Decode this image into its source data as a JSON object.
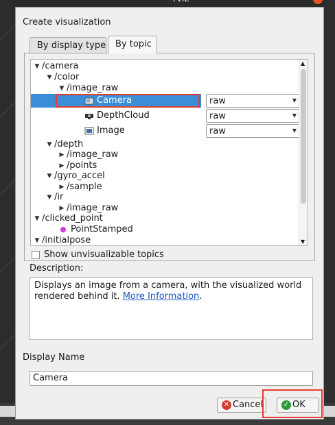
{
  "window": {
    "title": "rviz"
  },
  "dialog": {
    "heading": "Create visualization",
    "tabs": [
      {
        "label": "By display type",
        "active": false
      },
      {
        "label": "By topic",
        "active": true
      }
    ],
    "tree": [
      {
        "label": "/camera",
        "arrow": "down"
      },
      {
        "label": "/color",
        "arrow": "down"
      },
      {
        "label": "/image_raw",
        "arrow": "down"
      },
      {
        "label": "Camera",
        "icon": "camera-icon",
        "combo": "raw",
        "selected": true
      },
      {
        "label": "DepthCloud",
        "icon": "depthcloud-icon",
        "combo": "raw"
      },
      {
        "label": "Image",
        "icon": "image-icon",
        "combo": "raw"
      },
      {
        "label": "/depth",
        "arrow": "down"
      },
      {
        "label": "/image_raw",
        "arrow": "right"
      },
      {
        "label": "/points",
        "arrow": "right"
      },
      {
        "label": "/gyro_accel",
        "arrow": "down"
      },
      {
        "label": "/sample",
        "arrow": "right"
      },
      {
        "label": "/ir",
        "arrow": "down"
      },
      {
        "label": "/image_raw",
        "arrow": "right"
      },
      {
        "label": "/clicked_point",
        "arrow": "down"
      },
      {
        "label": "PointStamped",
        "icon": "point-icon"
      },
      {
        "label": "/initialpose",
        "arrow": "down"
      }
    ],
    "show_unvisualizable": {
      "label": "Show unvisualizable topics",
      "checked": false
    },
    "description_label": "Description:",
    "description": {
      "text_line1": "Displays an image from a camera, with the visualized world",
      "text_line2": "rendered behind it. ",
      "link": "More Information",
      "after_link": "."
    },
    "display_name_label": "Display Name",
    "display_name_value": "Camera",
    "buttons": {
      "cancel": "Cancel",
      "ok": "OK"
    }
  },
  "colors": {
    "selection": "#3a8ed8",
    "highlight": "#e53b2c",
    "point": "#d23bd8"
  }
}
